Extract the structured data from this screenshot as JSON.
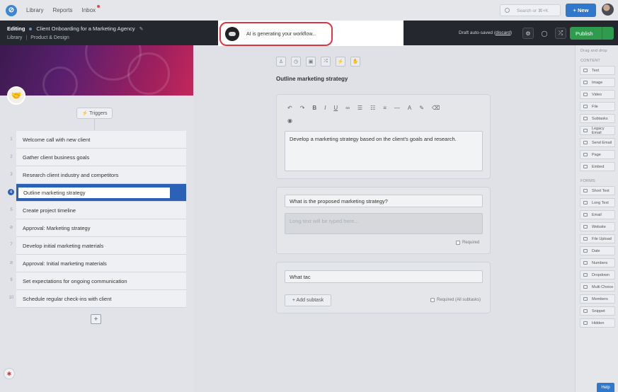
{
  "nav": {
    "library": "Library",
    "reports": "Reports",
    "inbox": "Inbox",
    "search_placeholder": "Search or ⌘+K",
    "new_button": "+ New"
  },
  "editbar": {
    "editing_label": "Editing",
    "workflow_title": "Client Onboarding for a Marketing Agency",
    "breadcrumb_root": "Library",
    "breadcrumb_folder": "Product & Design",
    "autosave_prefix": "Draft auto-saved (",
    "autosave_discard": "discard",
    "autosave_suffix": ")",
    "publish": "Publish"
  },
  "ai_popup": {
    "text": "AI is generating your workflow..."
  },
  "triggers_label": "Triggers",
  "tasks": [
    {
      "num": "1",
      "label": "Welcome call with new client"
    },
    {
      "num": "2",
      "label": "Gather client business goals"
    },
    {
      "num": "3",
      "label": "Research client industry and competitors"
    },
    {
      "num": "4",
      "label": "Outline marketing strategy"
    },
    {
      "num": "5",
      "label": "Create project timeline"
    },
    {
      "num": "",
      "label": "Approval: Marketing strategy"
    },
    {
      "num": "7",
      "label": "Develop initial marketing materials"
    },
    {
      "num": "",
      "label": "Approval: Initial marketing materials"
    },
    {
      "num": "9",
      "label": "Set expectations for ongoing communication"
    },
    {
      "num": "10",
      "label": "Schedule regular check-ins with client"
    }
  ],
  "editor": {
    "task_title": "Outline marketing strategy",
    "description": "Develop a marketing strategy based on the client's goals and research.",
    "question1": "What is the proposed marketing strategy?",
    "long_text_placeholder": "Long text will be typed here...",
    "required_label": "Required",
    "question2": "What tac",
    "add_subtask": "+ Add subtask",
    "required_all_label": "Required (All subtasks)"
  },
  "right_panel": {
    "drag_hint": "Drag and drop",
    "content_header": "CONTENT",
    "content_items": [
      "Text",
      "Image",
      "Video",
      "File",
      "Subtasks",
      "Legacy Email",
      "Send Email",
      "Page",
      "Embed"
    ],
    "forms_header": "FORMS",
    "form_items": [
      "Short Text",
      "Long Text",
      "Email",
      "Website",
      "File Upload",
      "Date",
      "Numbers",
      "Dropdown",
      "Multi Choice",
      "Members",
      "Snippet",
      "Hidden"
    ]
  },
  "help_button": "Help"
}
